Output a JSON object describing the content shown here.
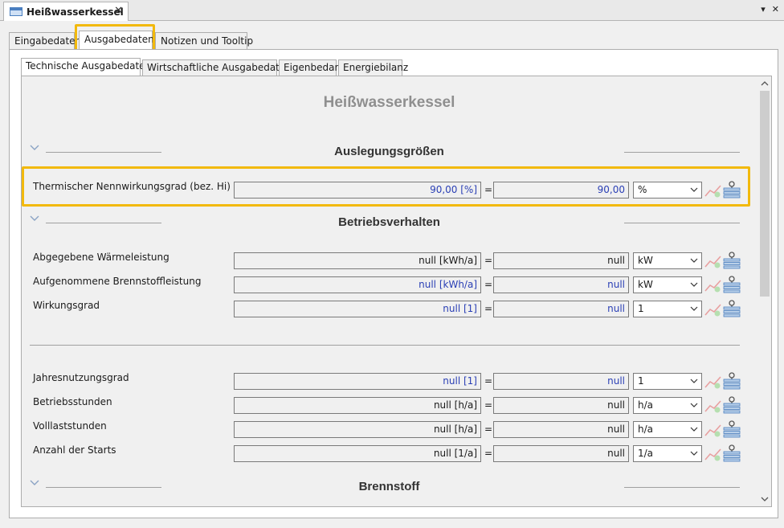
{
  "window": {
    "tab_title": "Heißwasserkessel",
    "close_glyph": "✕",
    "controls": [
      "▾",
      "✕"
    ]
  },
  "tabs": {
    "top": [
      "Eingabedaten",
      "Ausgabedaten",
      "Notizen und Tooltip"
    ],
    "top_active": "Ausgabedaten",
    "sub": [
      "Technische Ausgabedaten",
      "Wirtschaftliche Ausgabedaten",
      "Eigenbedarf",
      "Energiebilanz"
    ],
    "sub_active": "Technische Ausgabedaten"
  },
  "page_title": "Heißwasserkessel",
  "sections": {
    "auslegung": {
      "title": "Auslegungsgrößen"
    },
    "betrieb": {
      "title": "Betriebsverhalten"
    },
    "brennstoff": {
      "title": "Brennstoff"
    }
  },
  "rows": [
    {
      "label": "Thermischer Nennwirkungsgrad (bez. Hi)",
      "value": "90,00 [%]",
      "converted": "90,00",
      "unit": "%",
      "style": "blue"
    },
    {
      "label": "Abgegebene Wärmeleistung",
      "value": "null [kWh/a]",
      "converted": "null",
      "unit": "kW",
      "style": "dark"
    },
    {
      "label": "Aufgenommene Brennstoffleistung",
      "value": "null [kWh/a]",
      "converted": "null",
      "unit": "kW",
      "style": "blue"
    },
    {
      "label": "Wirkungsgrad",
      "value": "null [1]",
      "converted": "null",
      "unit": "1",
      "style": "blue"
    },
    {
      "label": "Jahresnutzungsgrad",
      "value": "null [1]",
      "converted": "null",
      "unit": "1",
      "style": "blue"
    },
    {
      "label": "Betriebsstunden",
      "value": "null [h/a]",
      "converted": "null",
      "unit": "h/a",
      "style": "dark"
    },
    {
      "label": "Volllaststunden",
      "value": "null [h/a]",
      "converted": "null",
      "unit": "h/a",
      "style": "dark"
    },
    {
      "label": "Anzahl der Starts",
      "value": "null [1/a]",
      "converted": "null",
      "unit": "1/a",
      "style": "dark"
    }
  ],
  "equals_sign": "=",
  "icons": {
    "chevron": "chevron-down-icon",
    "chart": "trend-chart-icon",
    "list": "pinned-list-icon",
    "scroll_up": "scroll-up-arrow-icon",
    "scroll_down": "scroll-down-arrow-icon"
  },
  "colors": {
    "highlight": "#f2b90c",
    "value_blue": "#2a3fb5",
    "title_gray": "#8f8f8f"
  }
}
